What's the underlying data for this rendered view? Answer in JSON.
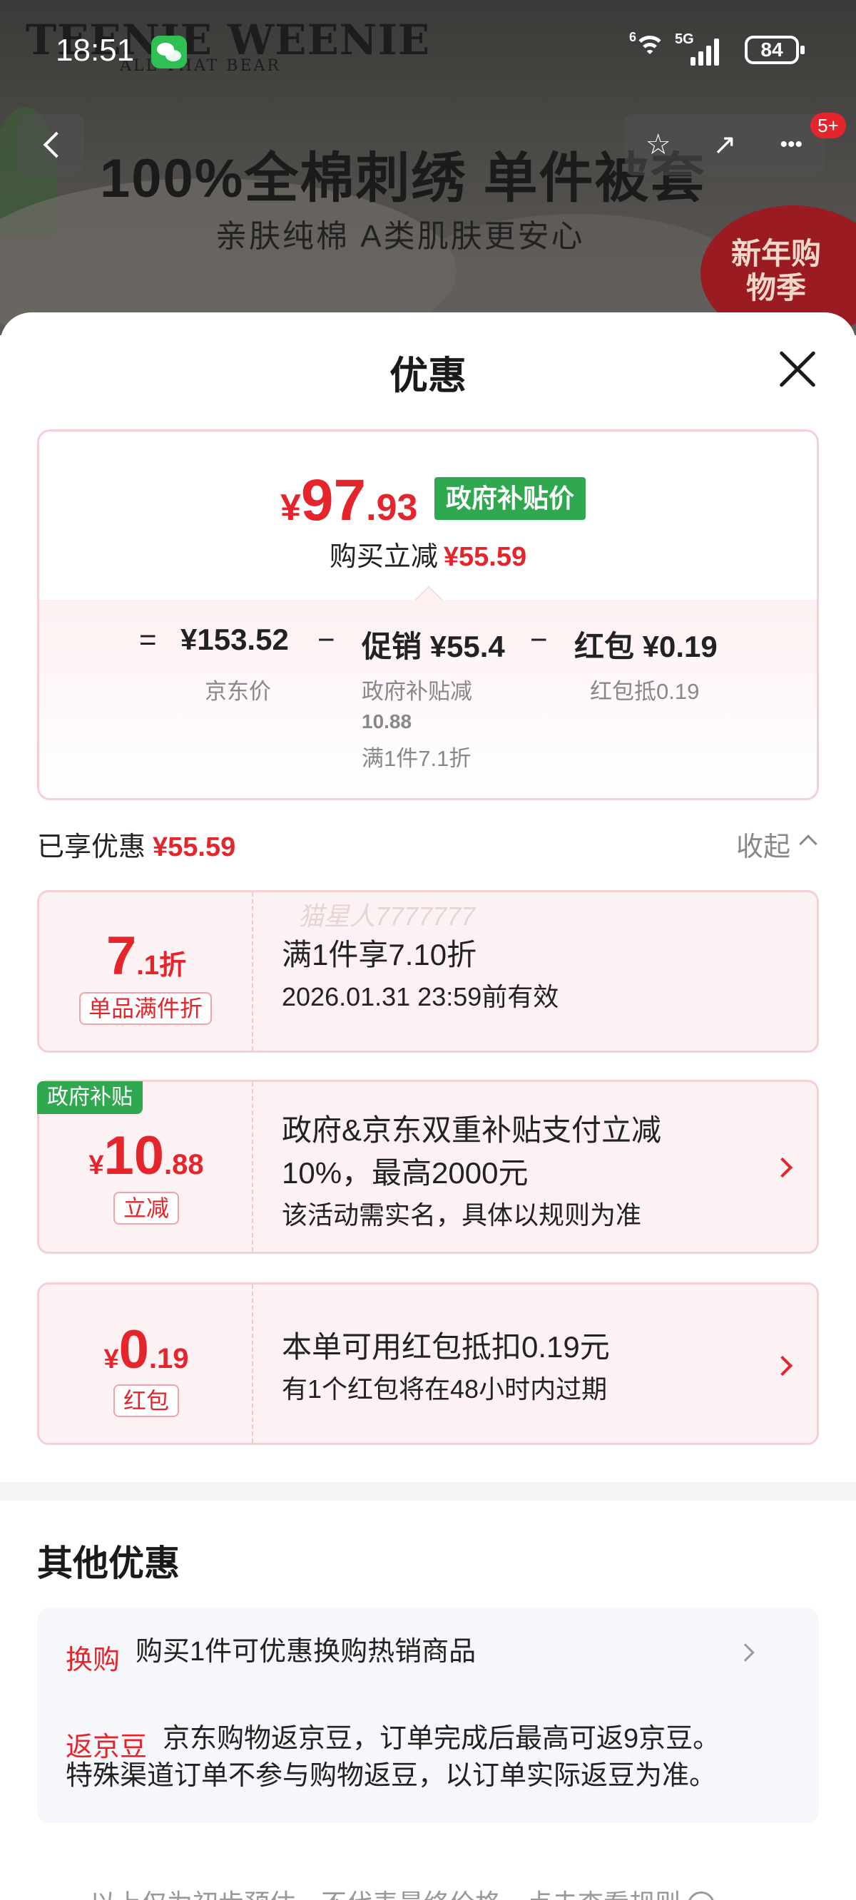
{
  "banner": {
    "brand": "TEENIE WEENIE",
    "brand_sub": "ALL THAT BEAR",
    "headline": "100%全棉刺绣 单件被套",
    "subline": "亲肤纯棉 A类肌肤更安心",
    "badge": "新年购物季"
  },
  "status_bar": {
    "time": "18:51",
    "wifi_label": "6",
    "signal_label": "5G",
    "battery": "84"
  },
  "nav": {
    "cart_badge": "5+",
    "star_icon": "☆",
    "share_icon": "↗",
    "more_icon": "•••"
  },
  "sheet": {
    "title": "优惠"
  },
  "price_card": {
    "yen": "¥",
    "price_int": "97",
    "price_dec": ".93",
    "gov_tag": "政府补贴价",
    "reduce_label": "购买立减",
    "reduce_value": "¥55.59",
    "eq": "=",
    "jd_price": "¥153.52",
    "jd_price_label": "京东价",
    "minus1": "−",
    "promo": "促销 ¥55.4",
    "promo_sub1": "政府补贴减",
    "promo_sub2": "10.88",
    "promo_sub3": "满1件7.1折",
    "minus2": "−",
    "hongbao": "红包 ¥0.19",
    "hongbao_sub": "红包抵0.19"
  },
  "enjoyed": {
    "label": "已享优惠",
    "value": "¥55.59",
    "collapse": "收起"
  },
  "coupons": [
    {
      "amount_int": "7",
      "amount_dec": ".1折",
      "tag": "单品满件折",
      "line1": "满1件享7.10折",
      "line2": "2026.01.31 23:59前有效"
    },
    {
      "corner": "政府补贴",
      "yen": "¥",
      "amount_int": "10",
      "amount_dec": ".88",
      "tag": "立减",
      "line1": "政府&京东双重补贴支付立减",
      "line1b": "10%，最高2000元",
      "line2": "该活动需实名，具体以规则为准"
    },
    {
      "yen": "¥",
      "amount_int": "0",
      "amount_dec": ".19",
      "tag": "红包",
      "line1": "本单可用红包抵扣0.19元",
      "line2": "有1个红包将在48小时内过期"
    }
  ],
  "watermark": "猫星人7777777",
  "other": {
    "title": "其他优惠",
    "items": [
      {
        "tag": "换购",
        "text": "购买1件可优惠换购热销商品"
      },
      {
        "tag": "返京豆",
        "text": "京东购物返京豆，订单完成后最高可返9京豆。",
        "text2": "特殊渠道订单不参与购物返豆，以订单实际返豆为准。"
      }
    ]
  },
  "footer": {
    "text": "以上仅为初步预估，不代表最终价格，点击查看规则"
  },
  "colors": {
    "accent_red": "#e4262c",
    "gov_green": "#2fa84f"
  }
}
